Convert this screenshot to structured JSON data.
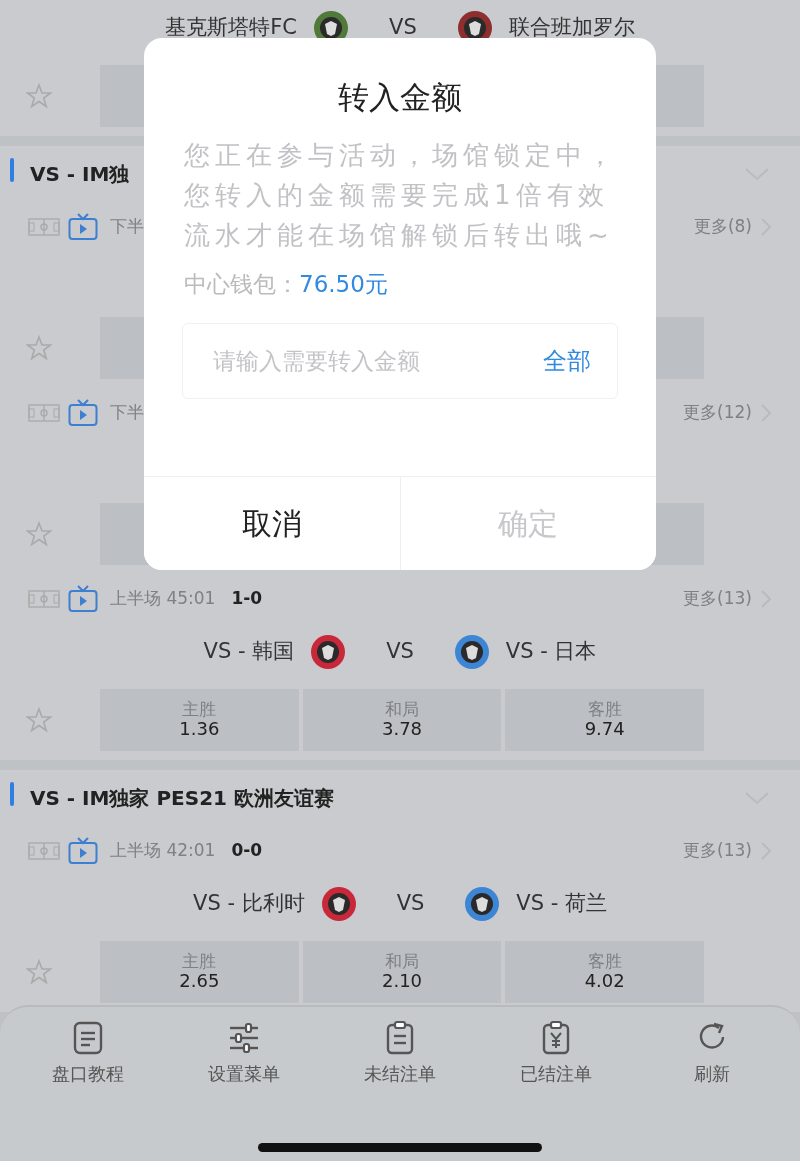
{
  "sections": [
    {
      "matches": [
        {
          "home": {
            "name": "基克斯塔特FC",
            "color": "#4f7a3a"
          },
          "vs": "VS",
          "away": {
            "name": "联合班加罗尔",
            "color": "#8e2e2e"
          }
        }
      ]
    },
    {
      "title": "VS - IM独",
      "matches": [
        {
          "status": "下半",
          "more": "更多(8)"
        },
        {
          "status": "下半",
          "more": "更多(12)"
        },
        {
          "status": "上半场 45:01",
          "score": "1-0",
          "more": "更多(13)",
          "home": {
            "name": "VS - 韩国",
            "color": "#c8283a"
          },
          "vs": "VS",
          "away": {
            "name": "VS - 日本",
            "color": "#3d86d6"
          },
          "odds": [
            {
              "label": "主胜",
              "value": "1.36"
            },
            {
              "label": "和局",
              "value": "3.78"
            },
            {
              "label": "客胜",
              "value": "9.74"
            }
          ]
        }
      ]
    },
    {
      "title": "VS - IM独家 PES21 欧洲友谊赛",
      "matches": [
        {
          "status": "上半场 42:01",
          "score": "0-0",
          "more": "更多(13)",
          "home": {
            "name": "VS - 比利时",
            "color": "#c8283a"
          },
          "vs": "VS",
          "away": {
            "name": "VS - 荷兰",
            "color": "#3d86d6"
          },
          "odds": [
            {
              "label": "主胜",
              "value": "2.65"
            },
            {
              "label": "和局",
              "value": "2.10"
            },
            {
              "label": "客胜",
              "value": "4.02"
            }
          ]
        }
      ]
    }
  ],
  "bottom_nav": [
    {
      "label": "盘口教程",
      "kind": "guide"
    },
    {
      "label": "设置菜单",
      "kind": "settings"
    },
    {
      "label": "未结注单",
      "kind": "open"
    },
    {
      "label": "已结注单",
      "kind": "settled"
    },
    {
      "label": "刷新",
      "kind": "refresh"
    }
  ],
  "dialog": {
    "title": "转入金额",
    "message": "您正在参与活动，场馆锁定中，您转入的金额需要完成1倍有效流水才能在场馆解锁后转出哦~",
    "wallet_label": "中心钱包：",
    "wallet_amount": "76.50元",
    "input": {
      "placeholder": "请输入需要转入金额"
    },
    "all_link": "全部",
    "buttons": [
      {
        "label": "取消",
        "disabled": false
      },
      {
        "label": "确定",
        "disabled": true
      }
    ]
  }
}
